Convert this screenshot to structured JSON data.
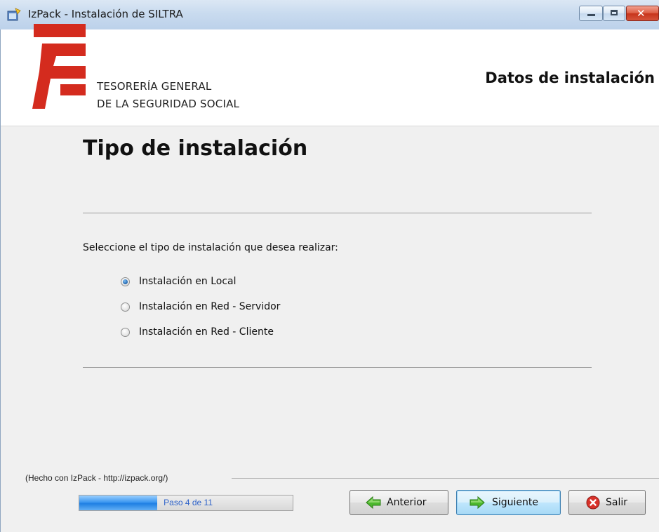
{
  "window": {
    "title": "IzPack - Instalación de  SILTRA",
    "controls": [
      "minimize",
      "maximize",
      "close"
    ],
    "close_glyph": "✕"
  },
  "header": {
    "org_line_1": "TESORERÍA GENERAL",
    "org_line_2": "DE LA SEGURIDAD SOCIAL",
    "title": "Datos de instalación",
    "logo_color": "#d42b1e"
  },
  "panel": {
    "title": "Tipo de instalación",
    "prompt": "Seleccione el tipo de instalación que desea realizar:",
    "options": [
      {
        "label": "Instalación en Local",
        "checked": true
      },
      {
        "label": "Instalación en Red - Servidor",
        "checked": false
      },
      {
        "label": "Instalación en Red - Cliente",
        "checked": false
      }
    ]
  },
  "footer": {
    "made_with": "(Hecho con IzPack - http://izpack.org/)",
    "progress": {
      "text": "Paso 4 de 11",
      "current": 4,
      "total": 11
    },
    "buttons": {
      "previous": "Anterior",
      "next": "Siguiente",
      "exit": "Salir"
    }
  },
  "icons": {
    "app": "installer-app-icon",
    "previous": "green-arrow-left-icon",
    "next": "green-arrow-right-icon",
    "exit": "red-close-circle-icon"
  }
}
